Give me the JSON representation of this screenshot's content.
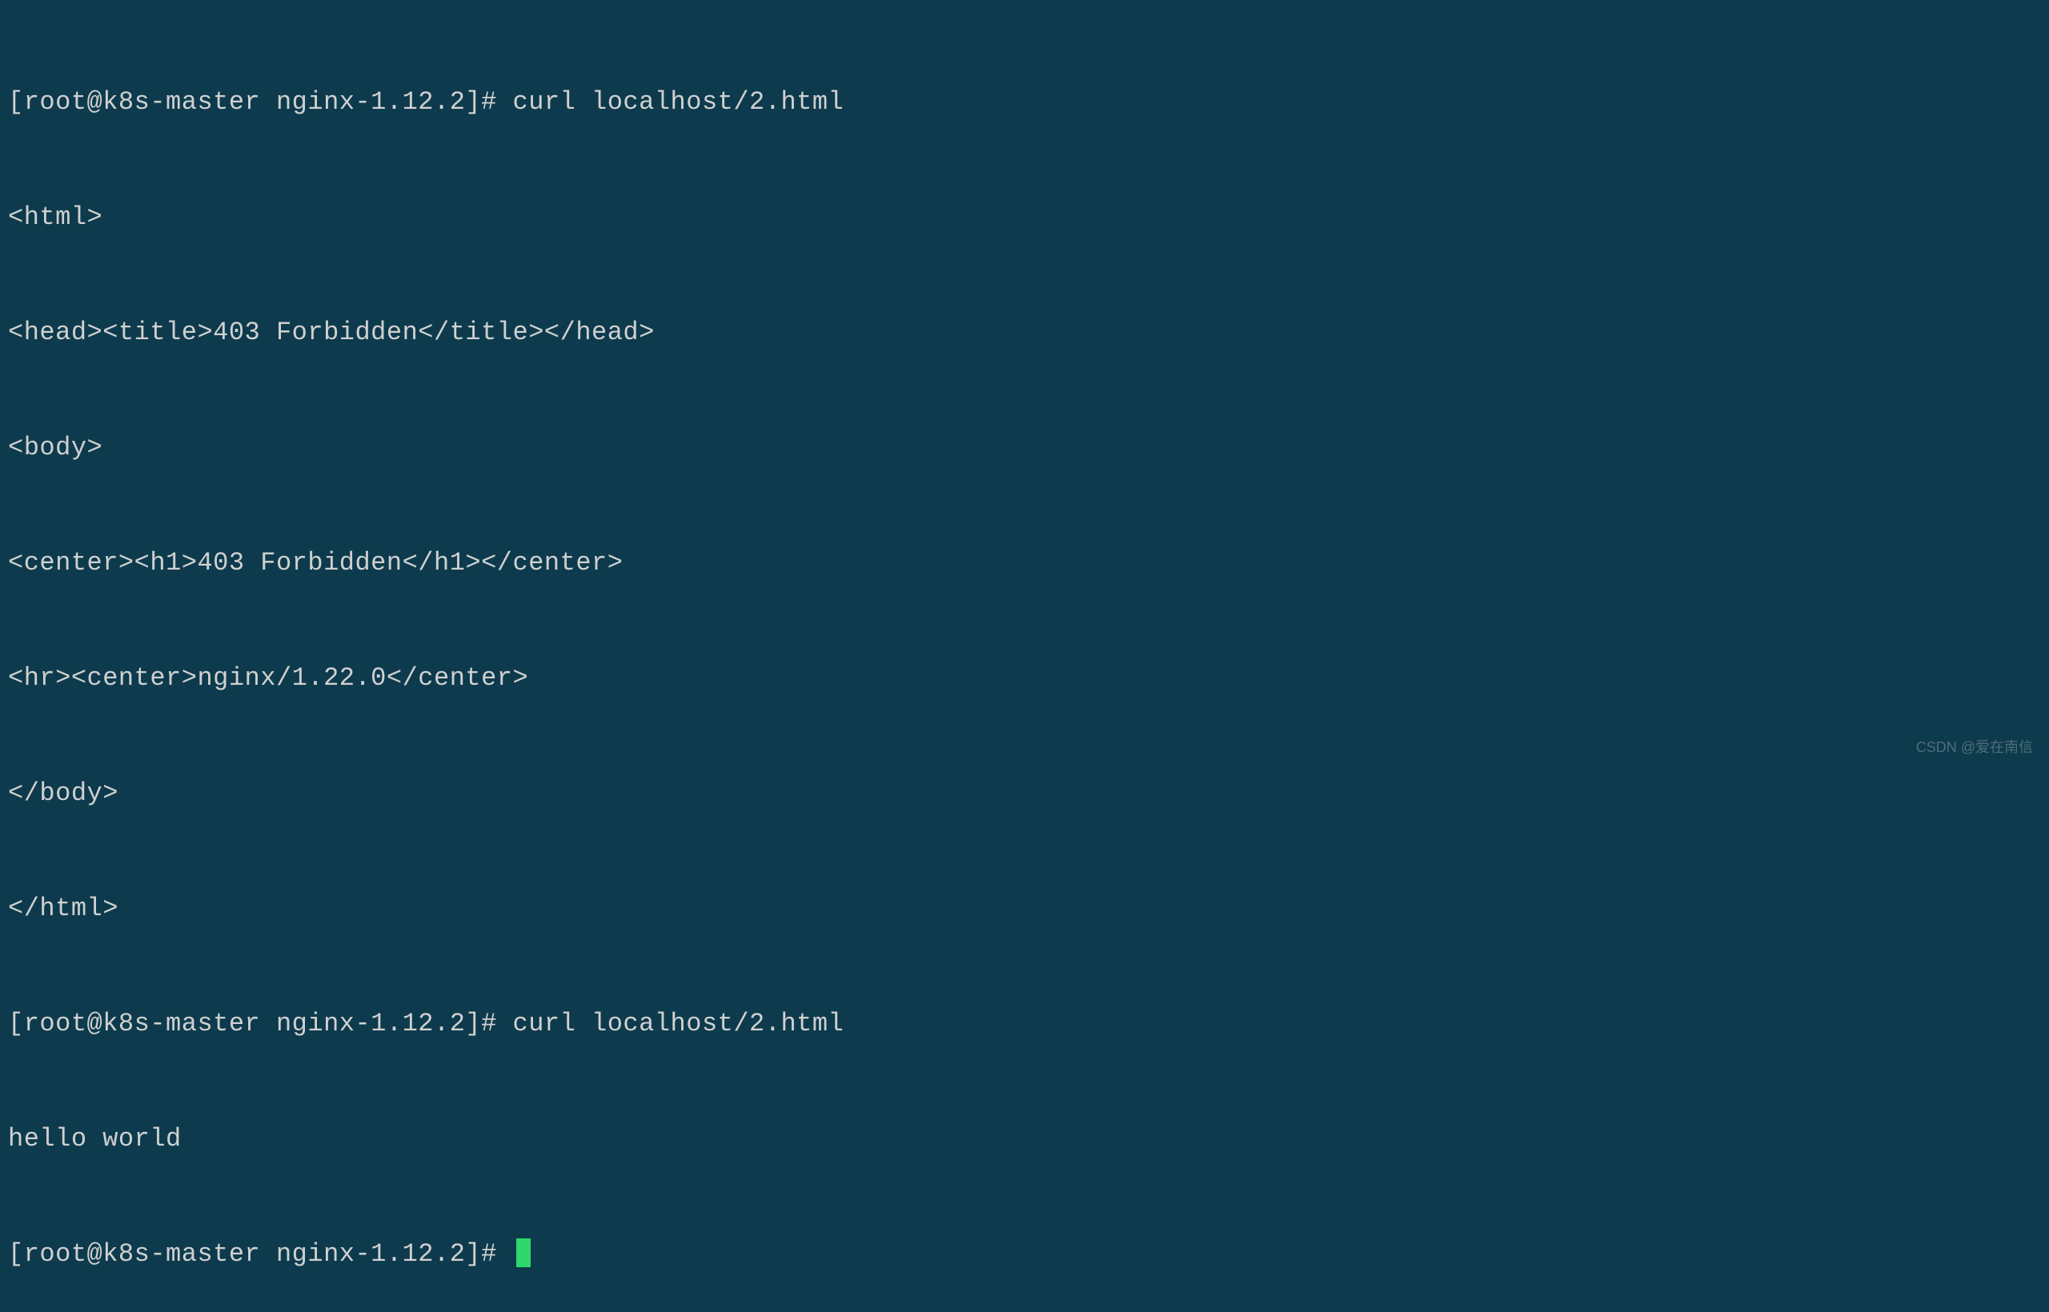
{
  "terminal": {
    "lines": [
      "[root@k8s-master nginx-1.12.2]# curl localhost/2.html",
      "<html>",
      "<head><title>403 Forbidden</title></head>",
      "<body>",
      "<center><h1>403 Forbidden</h1></center>",
      "<hr><center>nginx/1.22.0</center>",
      "</body>",
      "</html>",
      "[root@k8s-master nginx-1.12.2]# curl localhost/2.html",
      "hello world",
      "[root@k8s-master nginx-1.12.2]# "
    ]
  },
  "watermark": "CSDN @爱在南信"
}
